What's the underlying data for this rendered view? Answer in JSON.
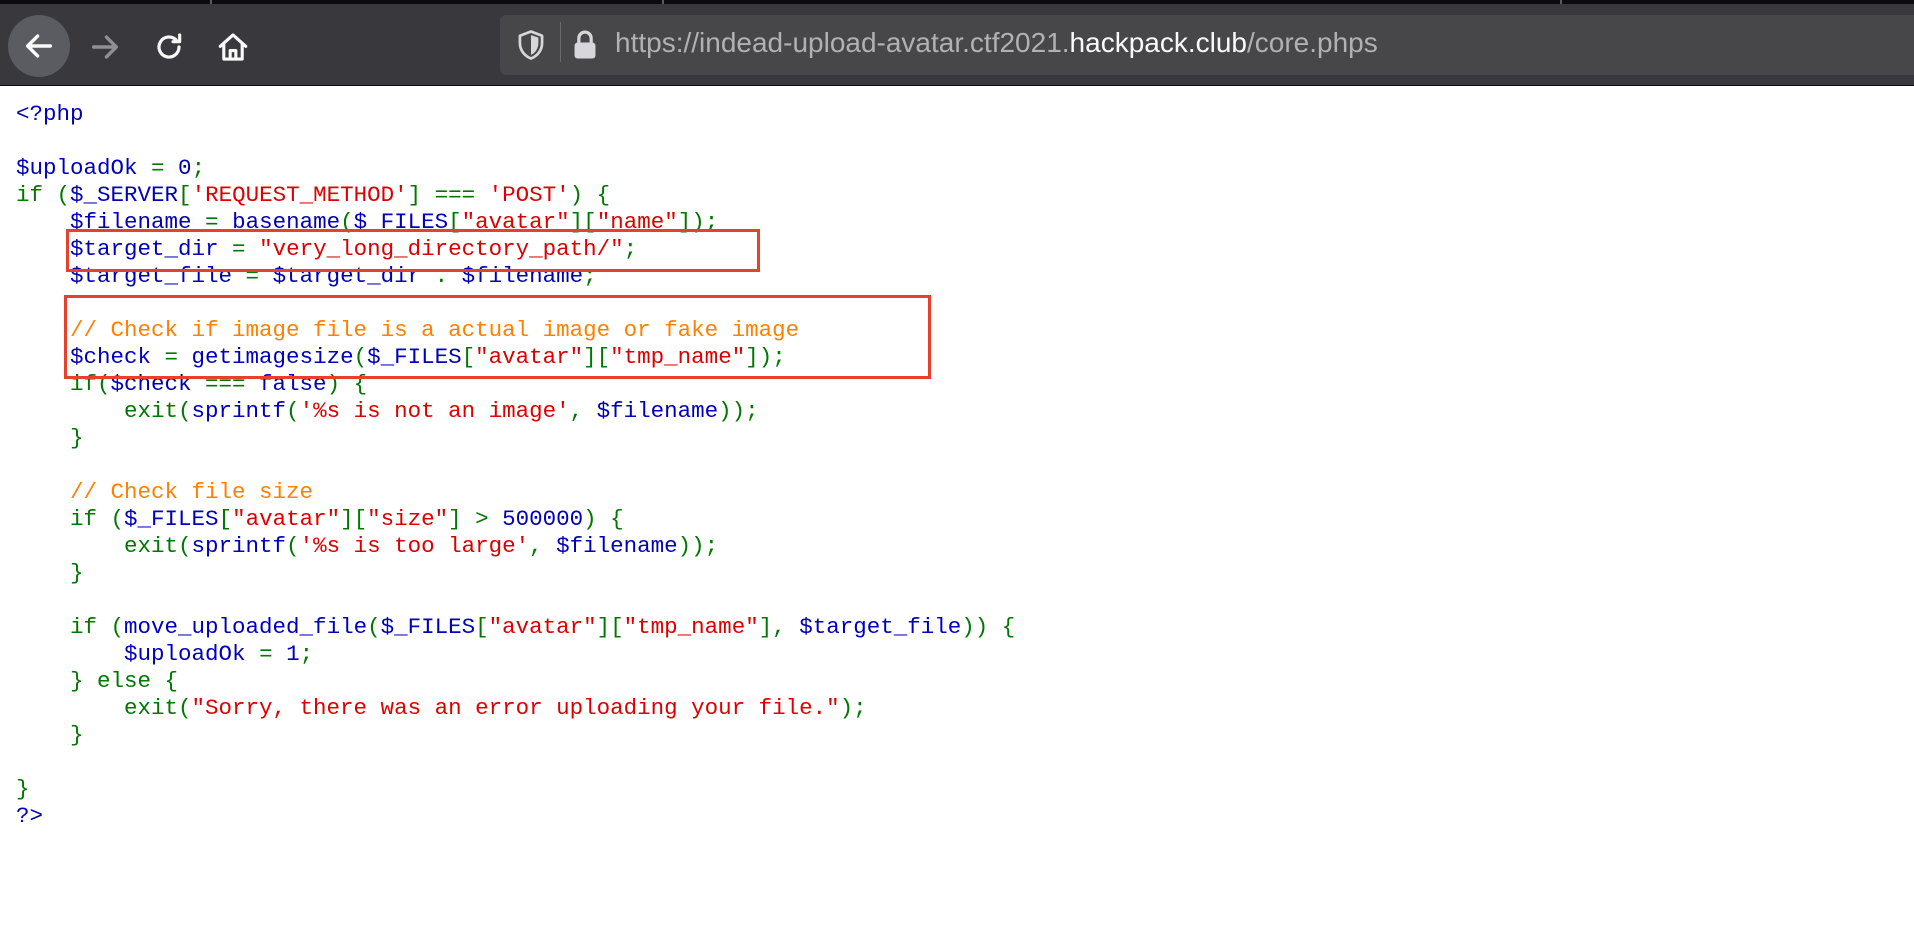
{
  "browser": {
    "url_secure_prefix": "https://",
    "url_domain_dim": "indead-upload-avatar.ctf2021.",
    "url_domain_main": "hackpack.club",
    "url_path": "/core.phps"
  },
  "code": {
    "lines": [
      [
        [
          "v",
          "<?php"
        ]
      ],
      [],
      [
        [
          "v",
          "$uploadOk "
        ],
        [
          "k",
          "= "
        ],
        [
          "v",
          "0"
        ],
        [
          "k",
          ";"
        ]
      ],
      [
        [
          "k",
          "if ("
        ],
        [
          "v",
          "$_SERVER"
        ],
        [
          "k",
          "["
        ],
        [
          "s",
          "'REQUEST_METHOD'"
        ],
        [
          "k",
          "] === "
        ],
        [
          "s",
          "'POST'"
        ],
        [
          "k",
          ") {"
        ]
      ],
      [
        [
          "k",
          "    "
        ],
        [
          "v",
          "$filename "
        ],
        [
          "k",
          "= "
        ],
        [
          "v",
          "basename"
        ],
        [
          "k",
          "("
        ],
        [
          "v",
          "$_FILES"
        ],
        [
          "k",
          "["
        ],
        [
          "s",
          "\"avatar\""
        ],
        [
          "k",
          "]["
        ],
        [
          "s",
          "\"name\""
        ],
        [
          "k",
          "]);"
        ]
      ],
      [
        [
          "k",
          "    "
        ],
        [
          "v",
          "$target_dir "
        ],
        [
          "k",
          "= "
        ],
        [
          "s",
          "\"very_long_directory_path/\""
        ],
        [
          "k",
          ";"
        ]
      ],
      [
        [
          "k",
          "    "
        ],
        [
          "v",
          "$target_file "
        ],
        [
          "k",
          "= "
        ],
        [
          "v",
          "$target_dir "
        ],
        [
          "k",
          ". "
        ],
        [
          "v",
          "$filename"
        ],
        [
          "k",
          ";"
        ]
      ],
      [],
      [
        [
          "k",
          "    "
        ],
        [
          "c",
          "// Check if image file is a actual image or fake image"
        ]
      ],
      [
        [
          "k",
          "    "
        ],
        [
          "v",
          "$check "
        ],
        [
          "k",
          "= "
        ],
        [
          "v",
          "getimagesize"
        ],
        [
          "k",
          "("
        ],
        [
          "v",
          "$_FILES"
        ],
        [
          "k",
          "["
        ],
        [
          "s",
          "\"avatar\""
        ],
        [
          "k",
          "]["
        ],
        [
          "s",
          "\"tmp_name\""
        ],
        [
          "k",
          "]);"
        ]
      ],
      [
        [
          "k",
          "    if("
        ],
        [
          "v",
          "$check "
        ],
        [
          "k",
          "=== "
        ],
        [
          "v",
          "false"
        ],
        [
          "k",
          ") {"
        ]
      ],
      [
        [
          "k",
          "        exit("
        ],
        [
          "v",
          "sprintf"
        ],
        [
          "k",
          "("
        ],
        [
          "s",
          "'%s is not an image'"
        ],
        [
          "k",
          ", "
        ],
        [
          "v",
          "$filename"
        ],
        [
          "k",
          "));"
        ]
      ],
      [
        [
          "k",
          "    }"
        ]
      ],
      [],
      [
        [
          "k",
          "    "
        ],
        [
          "c",
          "// Check file size"
        ]
      ],
      [
        [
          "k",
          "    if ("
        ],
        [
          "v",
          "$_FILES"
        ],
        [
          "k",
          "["
        ],
        [
          "s",
          "\"avatar\""
        ],
        [
          "k",
          "]["
        ],
        [
          "s",
          "\"size\""
        ],
        [
          "k",
          "] > "
        ],
        [
          "v",
          "500000"
        ],
        [
          "k",
          ") {"
        ]
      ],
      [
        [
          "k",
          "        exit("
        ],
        [
          "v",
          "sprintf"
        ],
        [
          "k",
          "("
        ],
        [
          "s",
          "'%s is too large'"
        ],
        [
          "k",
          ", "
        ],
        [
          "v",
          "$filename"
        ],
        [
          "k",
          "));"
        ]
      ],
      [
        [
          "k",
          "    }"
        ]
      ],
      [],
      [
        [
          "k",
          "    if ("
        ],
        [
          "v",
          "move_uploaded_file"
        ],
        [
          "k",
          "("
        ],
        [
          "v",
          "$_FILES"
        ],
        [
          "k",
          "["
        ],
        [
          "s",
          "\"avatar\""
        ],
        [
          "k",
          "]["
        ],
        [
          "s",
          "\"tmp_name\""
        ],
        [
          "k",
          "], "
        ],
        [
          "v",
          "$target_file"
        ],
        [
          "k",
          ")) {"
        ]
      ],
      [
        [
          "k",
          "        "
        ],
        [
          "v",
          "$uploadOk "
        ],
        [
          "k",
          "= "
        ],
        [
          "v",
          "1"
        ],
        [
          "k",
          ";"
        ]
      ],
      [
        [
          "k",
          "    } else {"
        ]
      ],
      [
        [
          "k",
          "        exit("
        ],
        [
          "s",
          "\"Sorry, there was an error uploading your file.\""
        ],
        [
          "k",
          ");"
        ]
      ],
      [
        [
          "k",
          "    }"
        ]
      ],
      [],
      [
        [
          "k",
          "}"
        ]
      ],
      [
        [
          "v",
          "?>"
        ]
      ]
    ]
  },
  "colors": {
    "keyword": "#007700",
    "variable": "#0000bb",
    "string": "#dd0000",
    "comment": "#ff8000",
    "highlight_box": "#e5412d"
  }
}
